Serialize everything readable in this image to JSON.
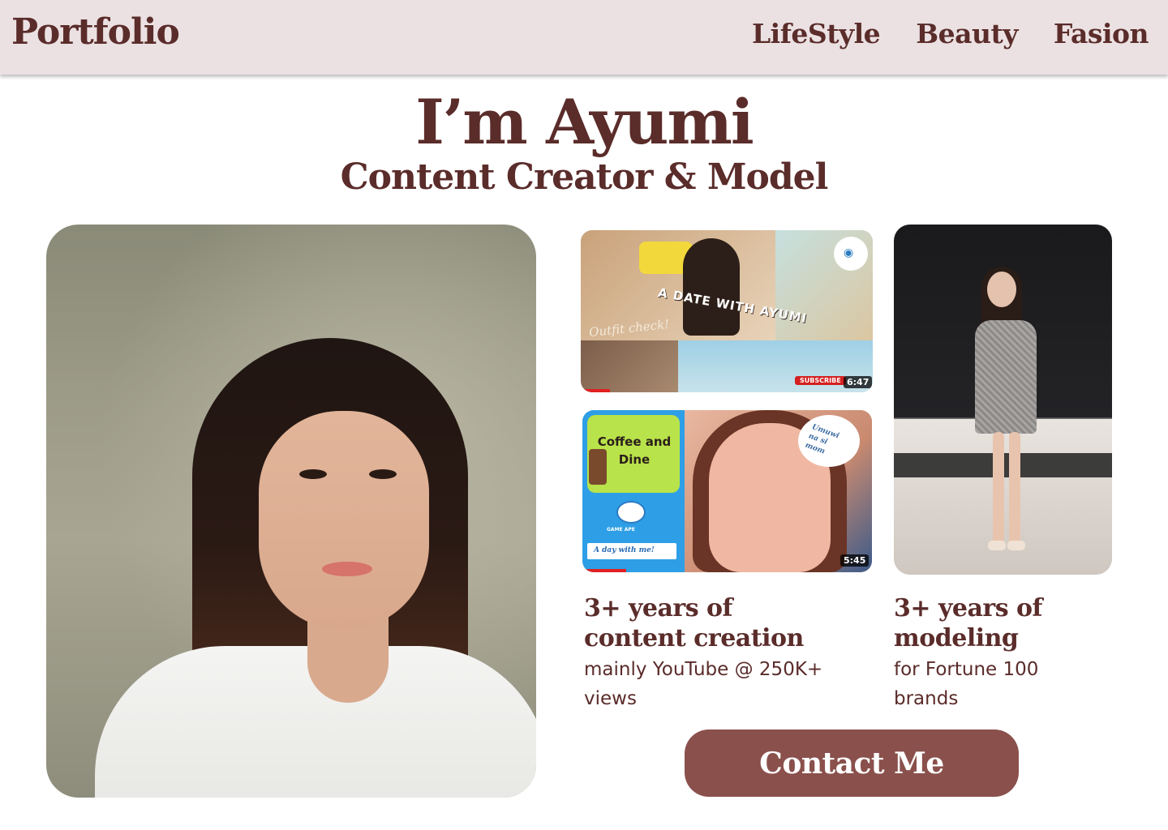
{
  "header": {
    "logo": "Portfolio",
    "nav": [
      "LifeStyle",
      "Beauty",
      "Fasion"
    ]
  },
  "hero": {
    "title": "I’m Ayumi",
    "subtitle": "Content Creator & Model"
  },
  "thumbnails": [
    {
      "overlay_text": "A DATE WITH AYUMI",
      "script_text": "Outfit check!",
      "subscribe_label": "SUBSCRIBE",
      "duration": "6:47"
    },
    {
      "title_line1": "Coffee and",
      "title_line2": "Dine",
      "brand": "GAME APE",
      "banner": "A day with me!",
      "bubble_line1": "Umuwi",
      "bubble_line2": "na si",
      "bubble_line3": "mom",
      "duration": "5:45"
    }
  ],
  "stats": [
    {
      "title_line1": "3+ years of",
      "title_line2": "content creation",
      "desc_line1": "mainly YouTube @ 250K+",
      "desc_line2": "views"
    },
    {
      "title_line1": "3+ years of",
      "title_line2": "modeling",
      "desc_line1": "for Fortune 100",
      "desc_line2": "brands"
    }
  ],
  "cta": {
    "label": "Contact Me"
  },
  "colors": {
    "brand": "#5a2c2a",
    "header_bg": "#ebe1e2",
    "button_bg": "#8a504c"
  }
}
